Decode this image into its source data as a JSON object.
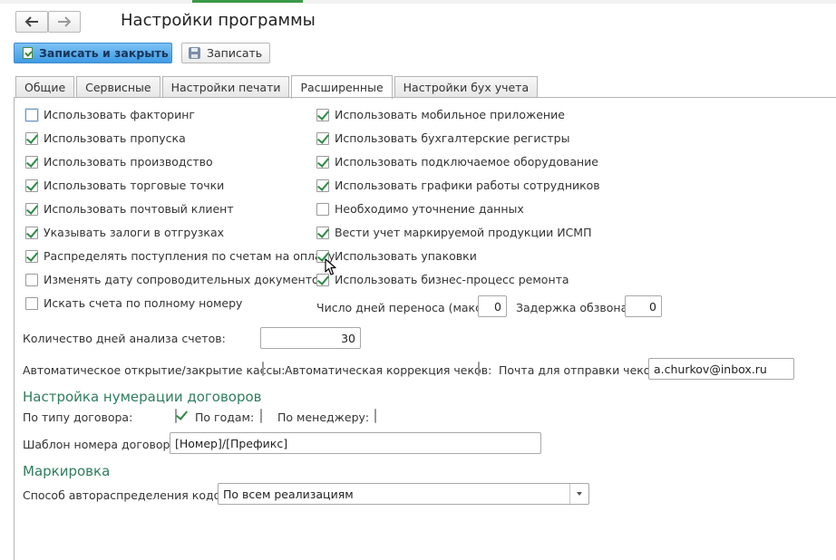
{
  "title": "Настройки программы",
  "nav": {
    "back_icon": "arrow-left-icon",
    "forward_icon": "arrow-right-icon"
  },
  "toolbar": {
    "save_close_label": "Записать и закрыть",
    "save_label": "Записать"
  },
  "tabs": [
    {
      "label": "Общие"
    },
    {
      "label": "Сервисные"
    },
    {
      "label": "Настройки печати"
    },
    {
      "label": "Расширенные",
      "active": true
    },
    {
      "label": "Настройки бух учета"
    }
  ],
  "left_checks": [
    {
      "label": "Использовать факторинг",
      "checked": false
    },
    {
      "label": "Использовать пропуска",
      "checked": true
    },
    {
      "label": "Использовать производство",
      "checked": true
    },
    {
      "label": "Использовать торговые точки",
      "checked": true
    },
    {
      "label": "Использовать почтовый клиент",
      "checked": true
    },
    {
      "label": "Указывать залоги в отгрузках",
      "checked": true
    },
    {
      "label": "Распределять поступления по счетам на оплату",
      "checked": true
    },
    {
      "label": "Изменять дату сопроводительных документов",
      "checked": false
    },
    {
      "label": "Искать счета по полному номеру",
      "checked": false
    }
  ],
  "right_checks": [
    {
      "label": "Использовать мобильное приложение",
      "checked": true
    },
    {
      "label": "Использовать бухгалтерские регистры",
      "checked": true
    },
    {
      "label": "Использовать подключаемое оборудование",
      "checked": true
    },
    {
      "label": "Использовать графики работы сотрудников",
      "checked": true
    },
    {
      "label": "Необходимо уточнение данных",
      "checked": false
    },
    {
      "label": "Вести учет маркируемой продукции ИСМП",
      "checked": true
    },
    {
      "label": "Использовать упаковки",
      "checked": true
    },
    {
      "label": "Использовать бизнес-процесс ремонта",
      "checked": true
    }
  ],
  "transfer_days": {
    "label": "Число дней переноса (макс):",
    "value": "0"
  },
  "call_delay": {
    "label": "Задержка обзвона:",
    "value": "0"
  },
  "analysis_days": {
    "label": "Количество дней анализа счетов:",
    "value": "30"
  },
  "auto_cash": {
    "label": "Автоматическое открытие/закрытие кассы:",
    "checked": false
  },
  "auto_receipt": {
    "label": "Автоматическая коррекция чеков:",
    "checked": false
  },
  "receipt_email": {
    "label": "Почта для отправки чеков:",
    "value": "a.churkov@inbox.ru"
  },
  "contract_numbering": {
    "header": "Настройка нумерации договоров",
    "by_type": {
      "label": "По типу договора:",
      "checked": true
    },
    "by_year": {
      "label": "По годам:",
      "checked": false
    },
    "by_manager": {
      "label": "По менеджеру:",
      "checked": false
    },
    "template": {
      "label": "Шаблон номера договора:",
      "value": "[Номер]/[Префикс]"
    }
  },
  "marking": {
    "header": "Маркировка",
    "distribution": {
      "label": "Способ автораспределения кодов:",
      "value": "По всем реализациям"
    }
  }
}
